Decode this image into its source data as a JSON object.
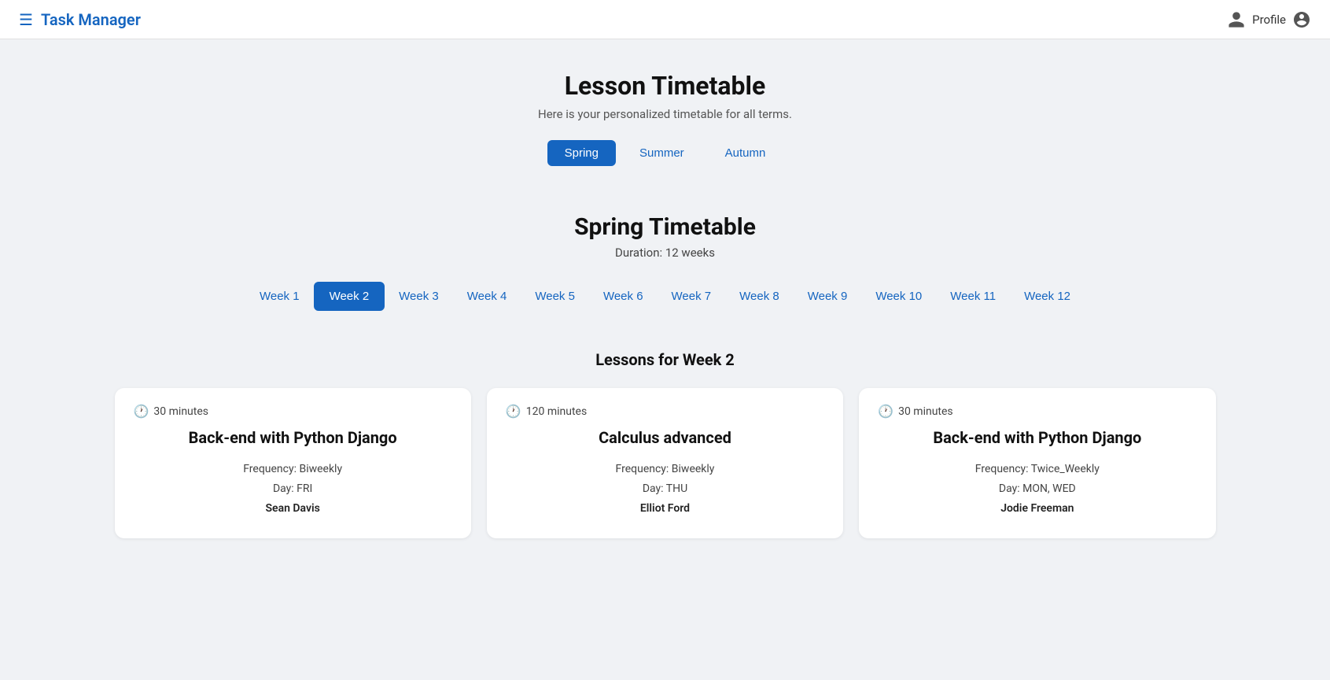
{
  "header": {
    "logo_icon": "☰",
    "title": "Task Manager",
    "profile_label": "Profile"
  },
  "page": {
    "title": "Lesson Timetable",
    "subtitle": "Here is your personalized timetable for all terms."
  },
  "term_tabs": [
    {
      "label": "Spring",
      "active": true
    },
    {
      "label": "Summer",
      "active": false
    },
    {
      "label": "Autumn",
      "active": false
    }
  ],
  "timetable": {
    "title": "Spring Timetable",
    "duration": "Duration: 12 weeks"
  },
  "week_tabs": [
    {
      "label": "Week 1",
      "active": false
    },
    {
      "label": "Week 2",
      "active": true
    },
    {
      "label": "Week 3",
      "active": false
    },
    {
      "label": "Week 4",
      "active": false
    },
    {
      "label": "Week 5",
      "active": false
    },
    {
      "label": "Week 6",
      "active": false
    },
    {
      "label": "Week 7",
      "active": false
    },
    {
      "label": "Week 8",
      "active": false
    },
    {
      "label": "Week 9",
      "active": false
    },
    {
      "label": "Week 10",
      "active": false
    },
    {
      "label": "Week 11",
      "active": false
    },
    {
      "label": "Week 12",
      "active": false
    }
  ],
  "lessons_section_title": "Lessons for Week 2",
  "lessons": [
    {
      "duration": "30 minutes",
      "name": "Back-end with Python Django",
      "frequency": "Biweekly",
      "day": "FRI",
      "teacher": "Sean Davis"
    },
    {
      "duration": "120 minutes",
      "name": "Calculus advanced",
      "frequency": "Biweekly",
      "day": "THU",
      "teacher": "Elliot Ford"
    },
    {
      "duration": "30 minutes",
      "name": "Back-end with Python Django",
      "frequency": "Twice_Weekly",
      "day": "MON, WED",
      "teacher": "Jodie Freeman"
    }
  ]
}
